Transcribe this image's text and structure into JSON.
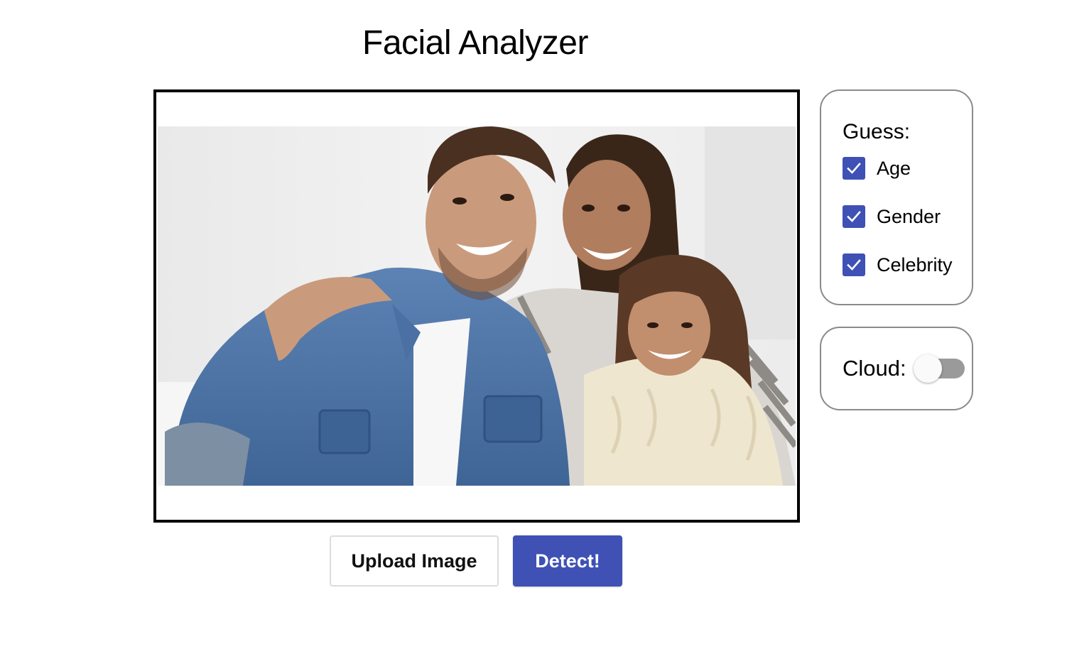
{
  "title": "Facial Analyzer",
  "image": {
    "description_icon": "family-photo"
  },
  "buttons": {
    "upload_label": "Upload Image",
    "detect_label": "Detect!"
  },
  "guess_panel": {
    "label": "Guess:",
    "options": [
      {
        "label": "Age",
        "checked": true
      },
      {
        "label": "Gender",
        "checked": true
      },
      {
        "label": "Celebrity",
        "checked": true
      }
    ]
  },
  "cloud_panel": {
    "label": "Cloud:",
    "enabled": false
  },
  "colors": {
    "accent": "#3f51b5",
    "switch_off": "#9a9a9a"
  }
}
